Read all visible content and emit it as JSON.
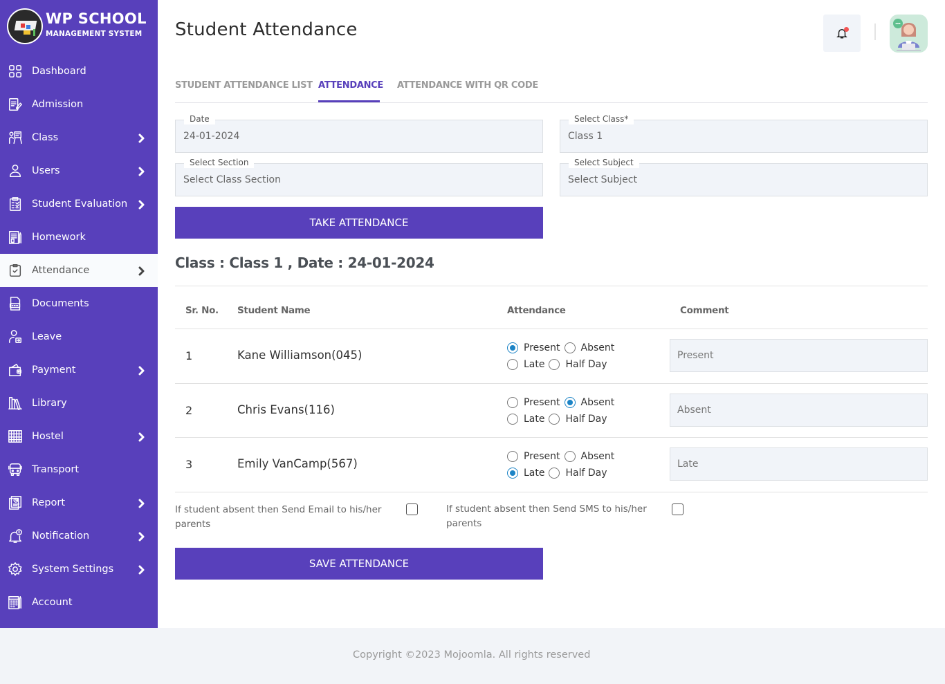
{
  "app": {
    "logo_title": "WP SCHOOL",
    "logo_subtitle": "MANAGEMENT SYSTEM",
    "brand_color": "#5840bb"
  },
  "sidebar": {
    "items": [
      {
        "label": "Dashboard",
        "icon": "dashboard-grid-icon",
        "has_submenu": false,
        "active": false
      },
      {
        "label": "Admission",
        "icon": "admission-form-icon",
        "has_submenu": false,
        "active": false
      },
      {
        "label": "Class",
        "icon": "class-teacher-board-icon",
        "has_submenu": true,
        "active": false
      },
      {
        "label": "Users",
        "icon": "user-icon",
        "has_submenu": true,
        "active": false
      },
      {
        "label": "Student Evaluation",
        "icon": "evaluation-clipboard-icon",
        "has_submenu": true,
        "active": false
      },
      {
        "label": "Homework",
        "icon": "homework-notebook-icon",
        "has_submenu": false,
        "active": false
      },
      {
        "label": "Attendance",
        "icon": "attendance-checkbox-icon",
        "has_submenu": true,
        "active": true
      },
      {
        "label": "Documents",
        "icon": "document-file-icon",
        "has_submenu": false,
        "active": false
      },
      {
        "label": "Leave",
        "icon": "leave-user-exit-icon",
        "has_submenu": false,
        "active": false
      },
      {
        "label": "Payment",
        "icon": "wallet-icon",
        "has_submenu": true,
        "active": false
      },
      {
        "label": "Library",
        "icon": "library-books-icon",
        "has_submenu": false,
        "active": false
      },
      {
        "label": "Hostel",
        "icon": "hostel-building-icon",
        "has_submenu": true,
        "active": false
      },
      {
        "label": "Transport",
        "icon": "bus-icon",
        "has_submenu": false,
        "active": false
      },
      {
        "label": "Report",
        "icon": "report-icon",
        "has_submenu": true,
        "active": false
      },
      {
        "label": "Notification",
        "icon": "notification-bell-icon",
        "has_submenu": true,
        "active": false
      },
      {
        "label": "System Settings",
        "icon": "gear-icon",
        "has_submenu": true,
        "active": false
      },
      {
        "label": "Account",
        "icon": "account-ledger-icon",
        "has_submenu": false,
        "active": false
      }
    ]
  },
  "header": {
    "title": "Student Attendance",
    "notification_icon": "bell-icon",
    "has_unread_notification": true,
    "avatar": "support-agent-avatar"
  },
  "tabs": [
    {
      "label": "STUDENT ATTENDANCE LIST",
      "active": false
    },
    {
      "label": "ATTENDANCE",
      "active": true
    },
    {
      "label": "ATTENDANCE WITH QR CODE",
      "active": false
    }
  ],
  "form": {
    "date": {
      "label": "Date",
      "value": "24-01-2024"
    },
    "class": {
      "label": "Select Class*",
      "value": "Class 1"
    },
    "section": {
      "label": "Select Section",
      "value": "Select Class Section"
    },
    "subject": {
      "label": "Select Subject",
      "value": "Select Subject"
    },
    "take_attendance_label": "TAKE ATTENDANCE"
  },
  "attendance": {
    "heading": "Class : Class 1 , Date : 24-01-2024",
    "columns": [
      "Sr. No.",
      "Student Name",
      "Attendance",
      "Comment"
    ],
    "options": [
      "Present",
      "Absent",
      "Late",
      "Half Day"
    ],
    "rows": [
      {
        "sr": "1",
        "name": "Kane Williamson(045)",
        "status": "Present",
        "comment": "Present"
      },
      {
        "sr": "2",
        "name": "Chris Evans(116)",
        "status": "Absent",
        "comment": "Absent"
      },
      {
        "sr": "3",
        "name": "Emily VanCamp(567)",
        "status": "Late",
        "comment": "Late"
      }
    ],
    "email_note": "If student absent then Send Email to his/her parents",
    "email_checked": false,
    "sms_note": "If student absent then Send SMS to his/her parents",
    "sms_checked": false,
    "save_label": "SAVE ATTENDANCE"
  },
  "footer": {
    "copyright": "Copyright ©2023 Mojoomla. All rights reserved"
  }
}
